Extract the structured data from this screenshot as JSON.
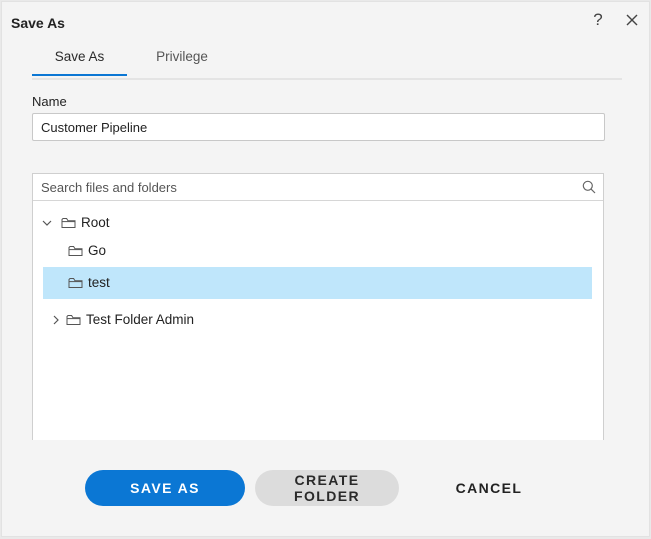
{
  "dialog": {
    "title": "Save As",
    "help_glyph": "?",
    "close_icon": "close-icon"
  },
  "tabs": [
    {
      "label": "Save As",
      "active": true
    },
    {
      "label": "Privilege",
      "active": false
    }
  ],
  "name_field": {
    "label": "Name",
    "value": "Customer Pipeline"
  },
  "search": {
    "placeholder": "Search files and folders",
    "icon": "search-icon"
  },
  "tree": [
    {
      "label": "Root",
      "expanded": true,
      "has_children": true,
      "selected": false,
      "icon": "folder-icon"
    },
    {
      "label": "Go",
      "expanded": false,
      "has_children": false,
      "selected": false,
      "icon": "folder-icon"
    },
    {
      "label": "test",
      "expanded": false,
      "has_children": false,
      "selected": true,
      "icon": "folder-icon"
    },
    {
      "label": "Test Folder Admin",
      "expanded": false,
      "has_children": true,
      "selected": false,
      "icon": "folder-icon"
    }
  ],
  "footer": {
    "save_label": "SAVE AS",
    "create_folder_label": "CREATE FOLDER",
    "cancel_label": "CANCEL"
  },
  "colors": {
    "accent": "#0b77d4",
    "selected_row": "#bfe6fb",
    "secondary_button": "#dcdcdc"
  }
}
